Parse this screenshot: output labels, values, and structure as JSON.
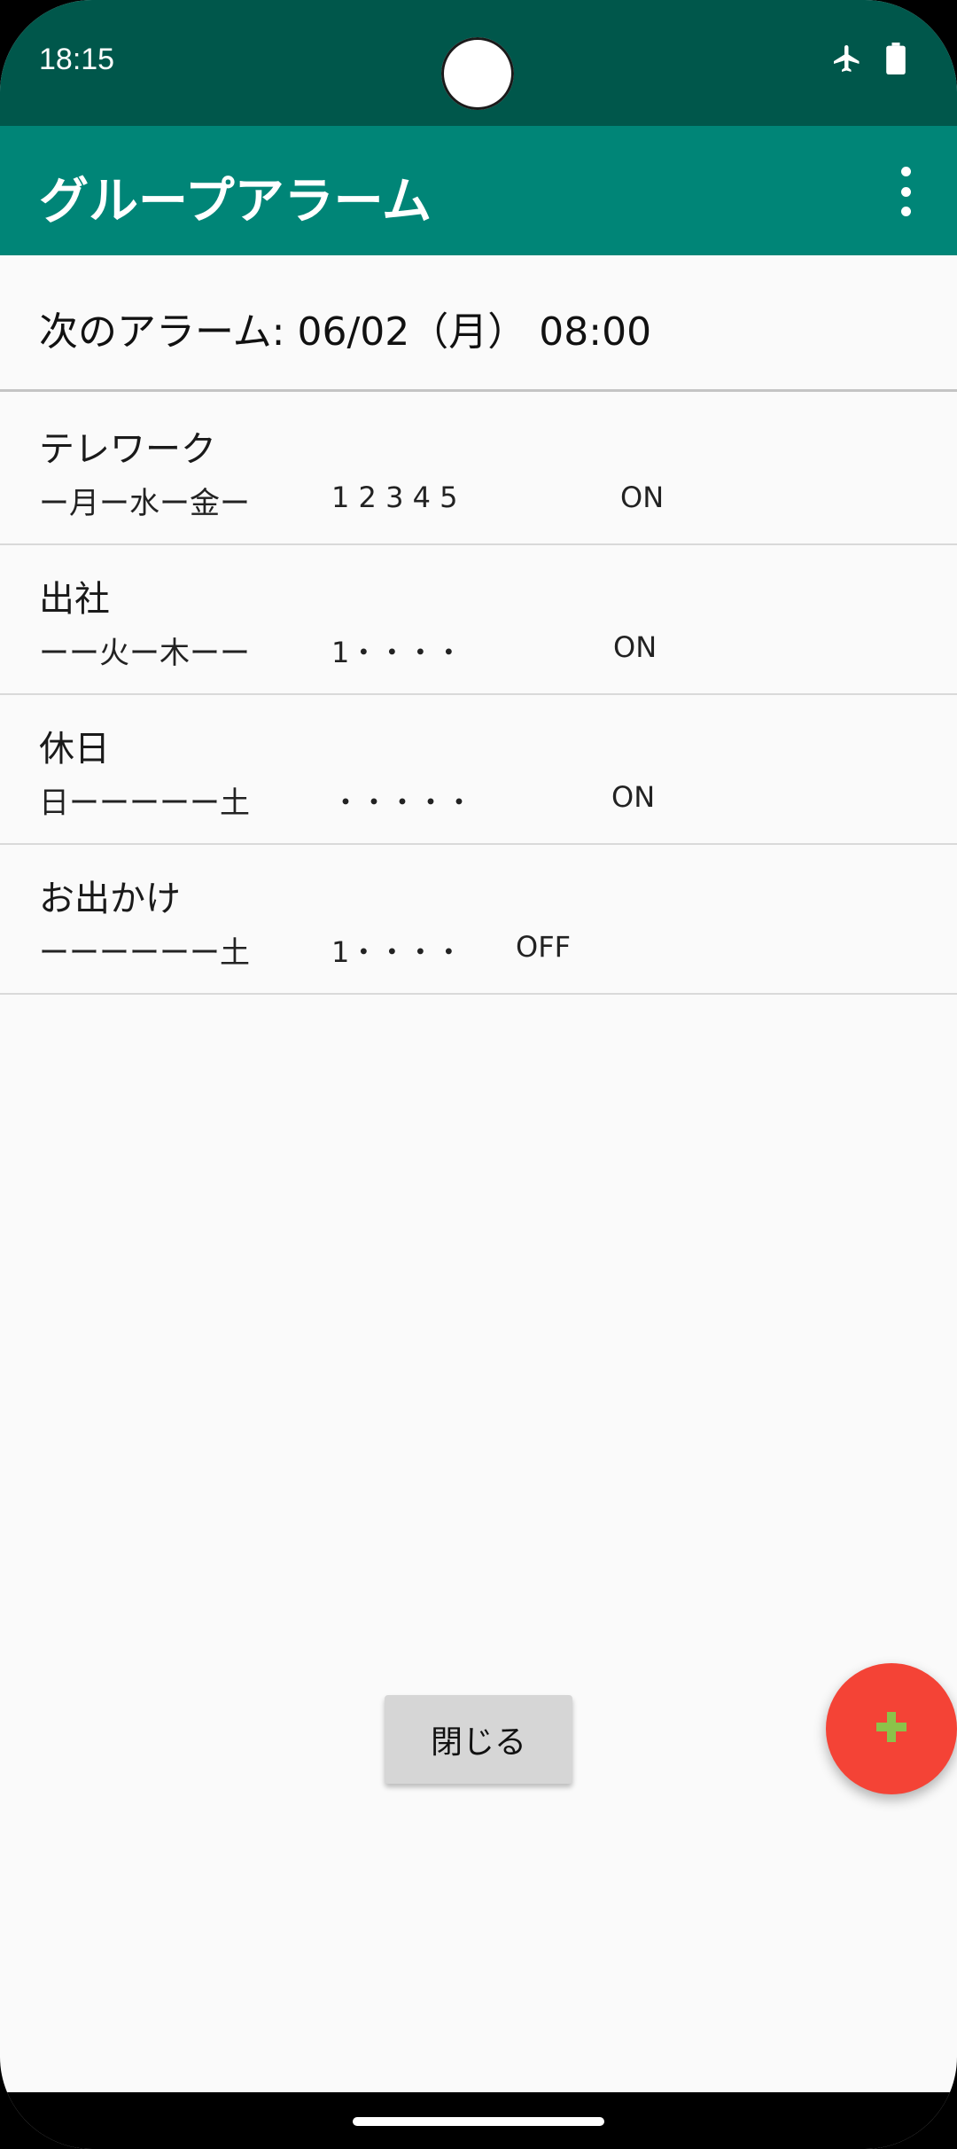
{
  "status_bar": {
    "time": "18:15",
    "icons": [
      "airplane-mode-icon",
      "battery-full-icon"
    ]
  },
  "app_bar": {
    "title": "グループアラーム",
    "menu_icon": "more-vert-icon"
  },
  "next_alarm": {
    "text": "次のアラーム: 06/02（月） 08:00"
  },
  "groups": [
    {
      "name": "テレワーク",
      "days": "ー月ー水ー金ー",
      "alarms": "1 2 3 4 5",
      "state": "ON"
    },
    {
      "name": "出社",
      "days": "ーー火ー木ーー",
      "alarms": "1・・・・",
      "state": "ON"
    },
    {
      "name": "休日",
      "days": "日ーーーーー土",
      "alarms": "・・・・・",
      "state": "ON"
    },
    {
      "name": "お出かけ",
      "days": "ーーーーーー土",
      "alarms": "1・・・・",
      "state": "OFF"
    }
  ],
  "close_button": {
    "label": "閉じる"
  },
  "fab": {
    "icon": "add-icon"
  },
  "colors": {
    "status_bar": "#00574b",
    "app_bar": "#008577",
    "fab": "#f44336",
    "fab_icon": "#8bc34a",
    "background": "#fafafa"
  }
}
